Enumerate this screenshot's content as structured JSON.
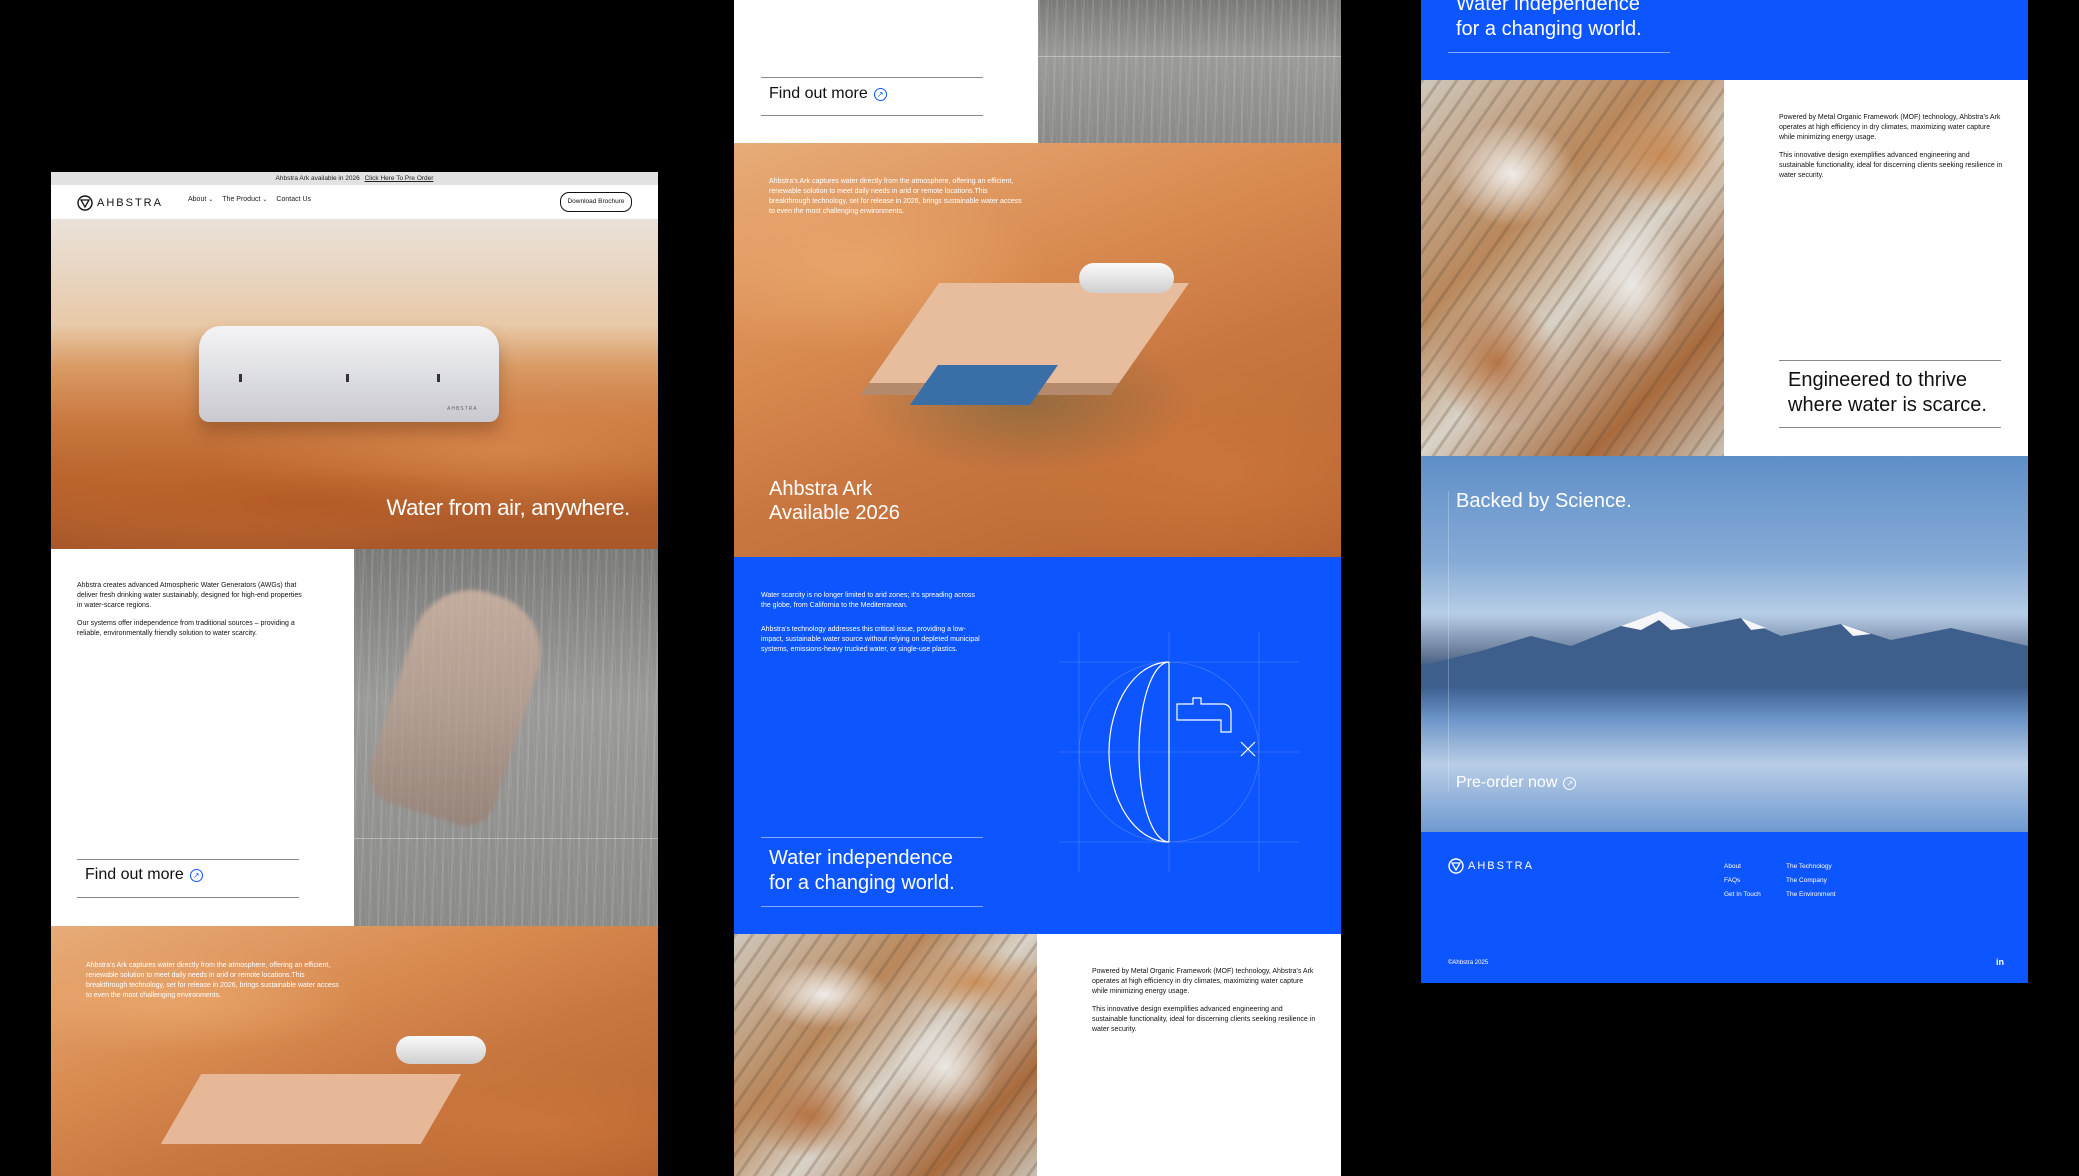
{
  "announcement": {
    "text": "Ahbstra Ark available in 2026",
    "link": "Click Here To Pre Order"
  },
  "nav": {
    "logo": "AHBSTRA",
    "about": "About",
    "product": "The Product",
    "contact": "Contact Us",
    "cta": "Download Brochure"
  },
  "hero": {
    "headline": "Water from air, anywhere.",
    "unit_label": "AHBSTRA"
  },
  "intro": {
    "p1": "Ahbstra creates advanced Atmospheric Water Generators (AWGs) that deliver fresh drinking water sustainably, designed for high-end properties in water-scarce regions.",
    "p2": "Our systems offer independence from traditional sources – providing a reliable, environmentally friendly solution to water scarcity.",
    "cta": "Find out more"
  },
  "ark": {
    "text": "Ahbstra's Ark captures water directly from the atmosphere, offering an efficient, renewable solution to meet daily needs in arid or remote locations.This breakthrough technology, set for release in 2026, brings sustainable water access to even the most challenging environments.",
    "headline_line1": "Ahbstra Ark",
    "headline_line2": "Available 2026"
  },
  "scarcity": {
    "p1": "Water scarcity is no longer limited to arid zones; it's spreading across the globe, from California to the Mediterranean.",
    "p2": "Ahbstra's technology addresses this critical issue, providing a low-impact, sustainable water source without relying on depleted municipal systems, emissions-heavy trucked water, or single-use plastics.",
    "headline_line1": "Water independence",
    "headline_line2": "for a changing world."
  },
  "mof": {
    "p1": "Powered by Metal Organic Framework (MOF) technology, Ahbstra's Ark operates at high efficiency in dry climates, maximizing water capture while minimizing energy usage.",
    "p2": "This innovative design exemplifies advanced engineering and sustainable functionality, ideal for discerning clients seeking resilience in water security.",
    "headline_line1": "Engineered to thrive",
    "headline_line2": "where water is scarce."
  },
  "science": {
    "headline": "Backed by Science.",
    "cta": "Pre-order now"
  },
  "footer": {
    "logo": "AHBSTRA",
    "col1": [
      "About",
      "FAQs",
      "Get In Touch"
    ],
    "col2": [
      "The Technology",
      "The Company",
      "The Environment"
    ],
    "copyright": "©Ahbstra 2025",
    "social": "in"
  },
  "colors": {
    "brand_blue": "#0d55ff",
    "ink": "#111111",
    "paper": "#ffffff"
  }
}
